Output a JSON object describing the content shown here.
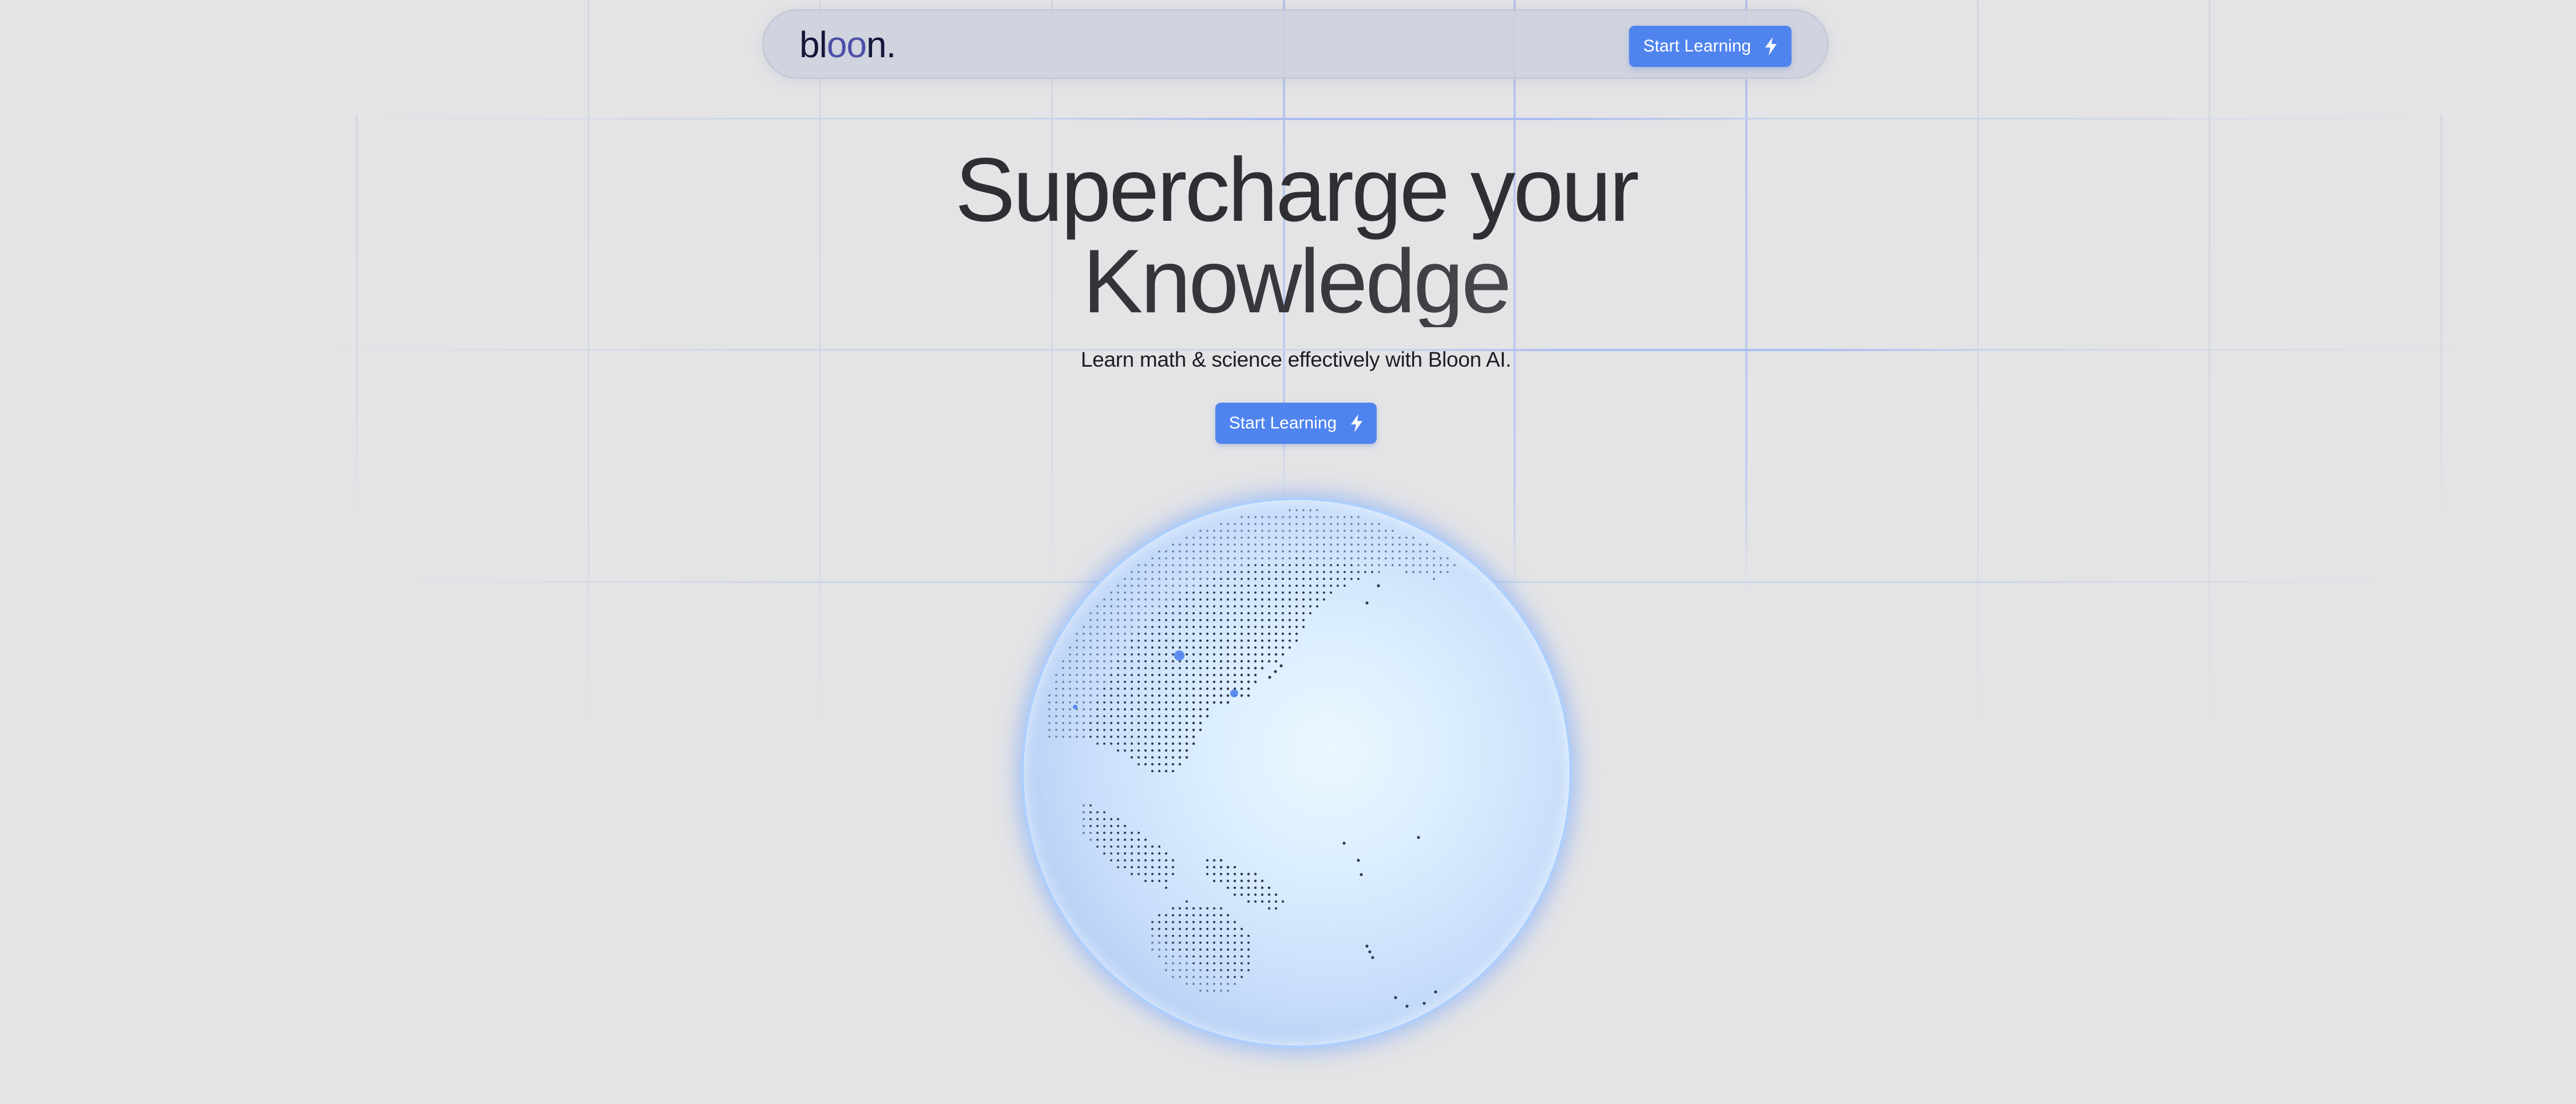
{
  "nav": {
    "logo_prefix": "bl",
    "logo_oo": "oo",
    "logo_suffix": "n.",
    "cta_label": "Start Learning",
    "cta_icon": "lightning-bolt-icon"
  },
  "hero": {
    "headline_line1": "Supercharge your",
    "headline_line2": "Knowledge",
    "subheadline": "Learn math & science effectively with Bloon AI.",
    "cta_label": "Start Learning",
    "cta_icon": "lightning-bolt-icon"
  },
  "colors": {
    "background": "#e4e4e6",
    "accent": "#4f83ee",
    "nav_background": "#cdd1de",
    "text": "#2f2f33",
    "logo": "#14163a",
    "logo_oo": "#4b4fa8",
    "globe_glow": "#78a5fa"
  },
  "globe": {
    "icon": "dotted-globe-illustration",
    "highlight_color": "#4f83ee"
  }
}
